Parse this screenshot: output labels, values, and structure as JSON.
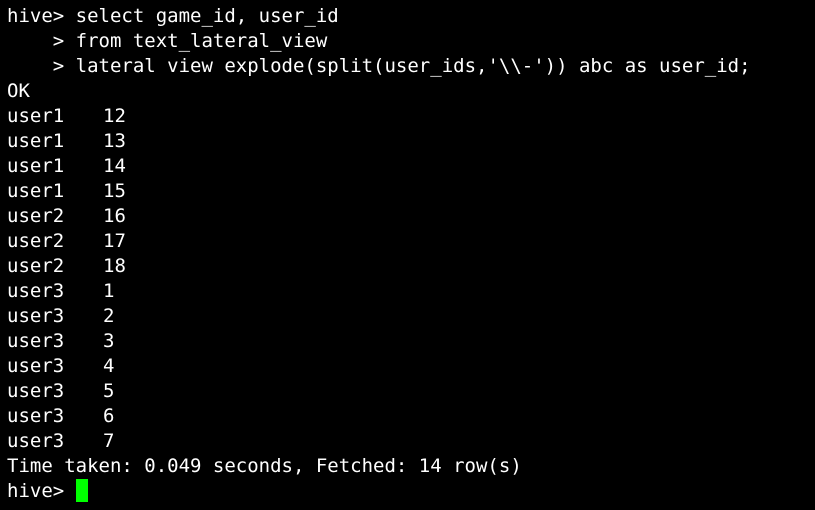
{
  "terminal": {
    "prompt": "hive> ",
    "continuation_prompt": "    > ",
    "query_lines": [
      "select game_id, user_id",
      "from text_lateral_view",
      "lateral view explode(split(user_ids,'\\\\-')) abc as user_id;"
    ],
    "status": "OK",
    "rows": [
      {
        "user": "user1",
        "id": "12"
      },
      {
        "user": "user1",
        "id": "13"
      },
      {
        "user": "user1",
        "id": "14"
      },
      {
        "user": "user1",
        "id": "15"
      },
      {
        "user": "user2",
        "id": "16"
      },
      {
        "user": "user2",
        "id": "17"
      },
      {
        "user": "user2",
        "id": "18"
      },
      {
        "user": "user3",
        "id": "1"
      },
      {
        "user": "user3",
        "id": "2"
      },
      {
        "user": "user3",
        "id": "3"
      },
      {
        "user": "user3",
        "id": "4"
      },
      {
        "user": "user3",
        "id": "5"
      },
      {
        "user": "user3",
        "id": "6"
      },
      {
        "user": "user3",
        "id": "7"
      }
    ],
    "summary": "Time taken: 0.049 seconds, Fetched: 14 row(s)",
    "cursor_color": "#00ff00",
    "background_color": "#000000",
    "text_color": "#ffffff"
  }
}
